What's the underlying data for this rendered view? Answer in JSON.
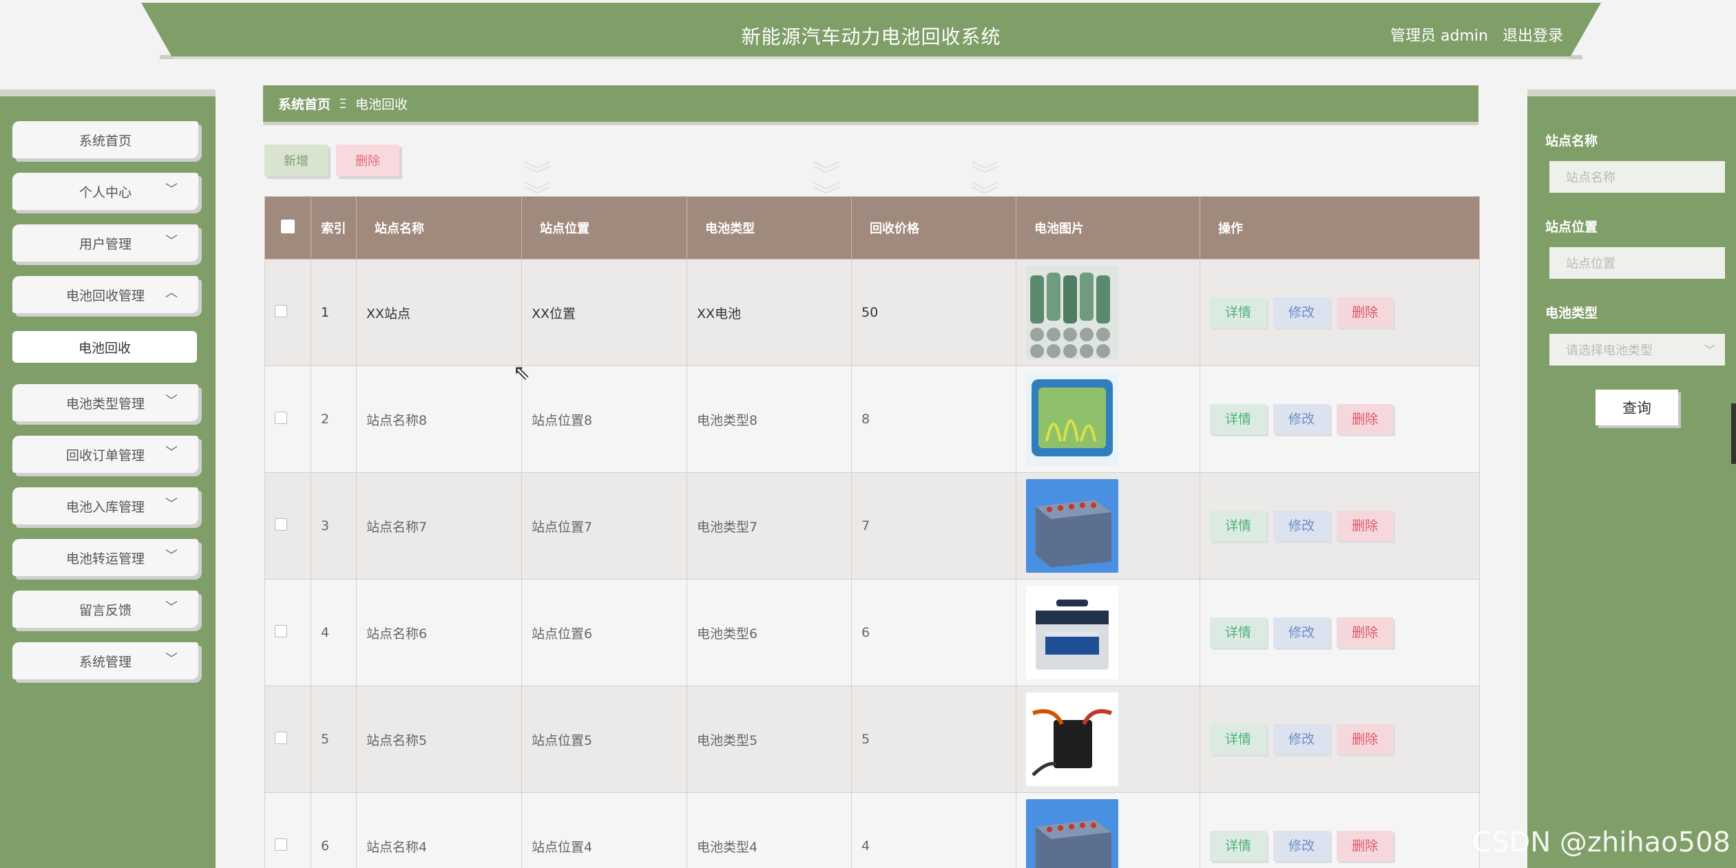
{
  "header": {
    "title": "新能源汽车动力电池回收系统",
    "user": "管理员 admin",
    "logout": "退出登录"
  },
  "sidebar": {
    "items": [
      {
        "label": "系统首页",
        "chevron": ""
      },
      {
        "label": "个人中心",
        "chevron": "﹀"
      },
      {
        "label": "用户管理",
        "chevron": "﹀"
      },
      {
        "label": "电池回收管理",
        "chevron": "︿"
      },
      {
        "label": "电池类型管理",
        "chevron": "﹀"
      },
      {
        "label": "回收订单管理",
        "chevron": "﹀"
      },
      {
        "label": "电池入库管理",
        "chevron": "﹀"
      },
      {
        "label": "电池转运管理",
        "chevron": "﹀"
      },
      {
        "label": "留言反馈",
        "chevron": "﹀"
      },
      {
        "label": "系统管理",
        "chevron": "﹀"
      }
    ],
    "sub_item": "电池回收"
  },
  "breadcrumb": {
    "home": "系统首页",
    "sep": "Ξ",
    "current": "电池回收"
  },
  "toolbar": {
    "add": "新增",
    "delete": "删除"
  },
  "table": {
    "headers": {
      "index": "索引",
      "name": "站点名称",
      "location": "站点位置",
      "type": "电池类型",
      "price": "回收价格",
      "image": "电池图片",
      "ops": "操作"
    },
    "ops": {
      "detail": "详情",
      "edit": "修改",
      "remove": "删除"
    },
    "rows": [
      {
        "index": "1",
        "name": "XX站点",
        "location": "XX位置",
        "type": "XX电池",
        "price": "50",
        "image": "cells-photo"
      },
      {
        "index": "2",
        "name": "站点名称8",
        "location": "站点位置8",
        "type": "电池类型8",
        "price": "8",
        "image": "grass-battery-photo"
      },
      {
        "index": "3",
        "name": "站点名称7",
        "location": "站点位置7",
        "type": "电池类型7",
        "price": "7",
        "image": "blue-pack-photo"
      },
      {
        "index": "4",
        "name": "站点名称6",
        "location": "站点位置6",
        "type": "电池类型6",
        "price": "6",
        "image": "car-battery-photo"
      },
      {
        "index": "5",
        "name": "站点名称5",
        "location": "站点位置5",
        "type": "电池类型5",
        "price": "5",
        "image": "jumper-cables-photo"
      },
      {
        "index": "6",
        "name": "站点名称4",
        "location": "站点位置4",
        "type": "电池类型4",
        "price": "4",
        "image": "blue-pack-photo"
      }
    ]
  },
  "filters": {
    "name_label": "站点名称",
    "name_placeholder": "站点名称",
    "location_label": "站点位置",
    "location_placeholder": "站点位置",
    "type_label": "电池类型",
    "type_placeholder": "请选择电池类型",
    "search": "查询"
  },
  "watermark": "CSDN @zhihao508"
}
